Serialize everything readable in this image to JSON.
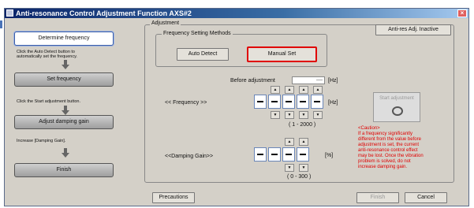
{
  "window": {
    "title": "Anti-resonance Control Adjustment Function AXS#2",
    "close_label": "×"
  },
  "steps": [
    {
      "label": "Determine frequency",
      "note": "Click the Auto Detect button to\nautomatically set the frequency."
    },
    {
      "label": "Set frequency",
      "note": "Click the Start adjustment button."
    },
    {
      "label": "Adjust damping gain",
      "note": "Increase [Damping Gain]."
    },
    {
      "label": "Finish"
    }
  ],
  "adjustment": {
    "group_label": "Adjustment",
    "anti_res_button": "Anti-res Adj. Inactive",
    "freq_methods": {
      "label": "Frequency Setting Methods",
      "auto_detect": "Auto Detect",
      "manual_set": "Manual Set"
    },
    "before_adjustment": {
      "label": "Before adjustment",
      "value": "----",
      "unit": "[Hz]"
    },
    "frequency": {
      "label": "<< Frequency >>",
      "unit": "[Hz]",
      "range": "( 1 - 2000 )"
    },
    "damping": {
      "label": "<<Damping Gain>>",
      "unit": "[%]",
      "range": "( 0 - 300 )"
    },
    "start_adjustment": "Start adjustment",
    "caution": [
      "<Caution>",
      "If a frequency significantly",
      "different from the value before",
      "adjustment is set, the current",
      "anti-resonance control effect",
      "may be lost. Once the vibration",
      "problem is solved, do not",
      "increase damping gain."
    ]
  },
  "footer": {
    "precautions": "Precautions",
    "finish": "Finish",
    "cancel": "Cancel"
  }
}
